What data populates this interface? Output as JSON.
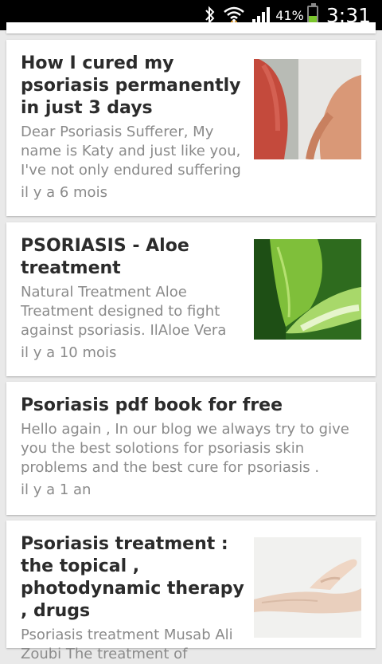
{
  "status_bar": {
    "battery_percent": "41%",
    "time": "3:31",
    "icons": [
      "bluetooth-icon",
      "wifi-icon",
      "signal-icon",
      "battery-icon"
    ]
  },
  "posts": [
    {
      "title": "How I cured my psoriasis permanently in just 3 days",
      "excerpt": "Dear Psoriasis Sufferer, My name is Katy and just like you, I've not only endured suffering",
      "age": "il y a 6 mois",
      "thumbnail": "arm-skin-photo"
    },
    {
      "title": "PSORIASIS - Aloe treatment",
      "excerpt": "Natural Treatment Aloe Treatment designed to fight against psoriasis. IlAloe Vera",
      "age": "il y a 10 mois",
      "thumbnail": "aloe-vera-photo"
    },
    {
      "title": "Psoriasis pdf book for free",
      "excerpt": "Hello again , In our blog we always try to give you the best solotions for psoriasis skin problems and the best cure for psoriasis .",
      "age": "il y a 1 an",
      "thumbnail": ""
    },
    {
      "title": "Psoriasis treatment : the topical , photodynamic therapy , drugs",
      "excerpt": "Psoriasis treatment  Musab Ali Zoubi     The treatment of",
      "age": "",
      "thumbnail": "hands-cream-photo"
    }
  ]
}
